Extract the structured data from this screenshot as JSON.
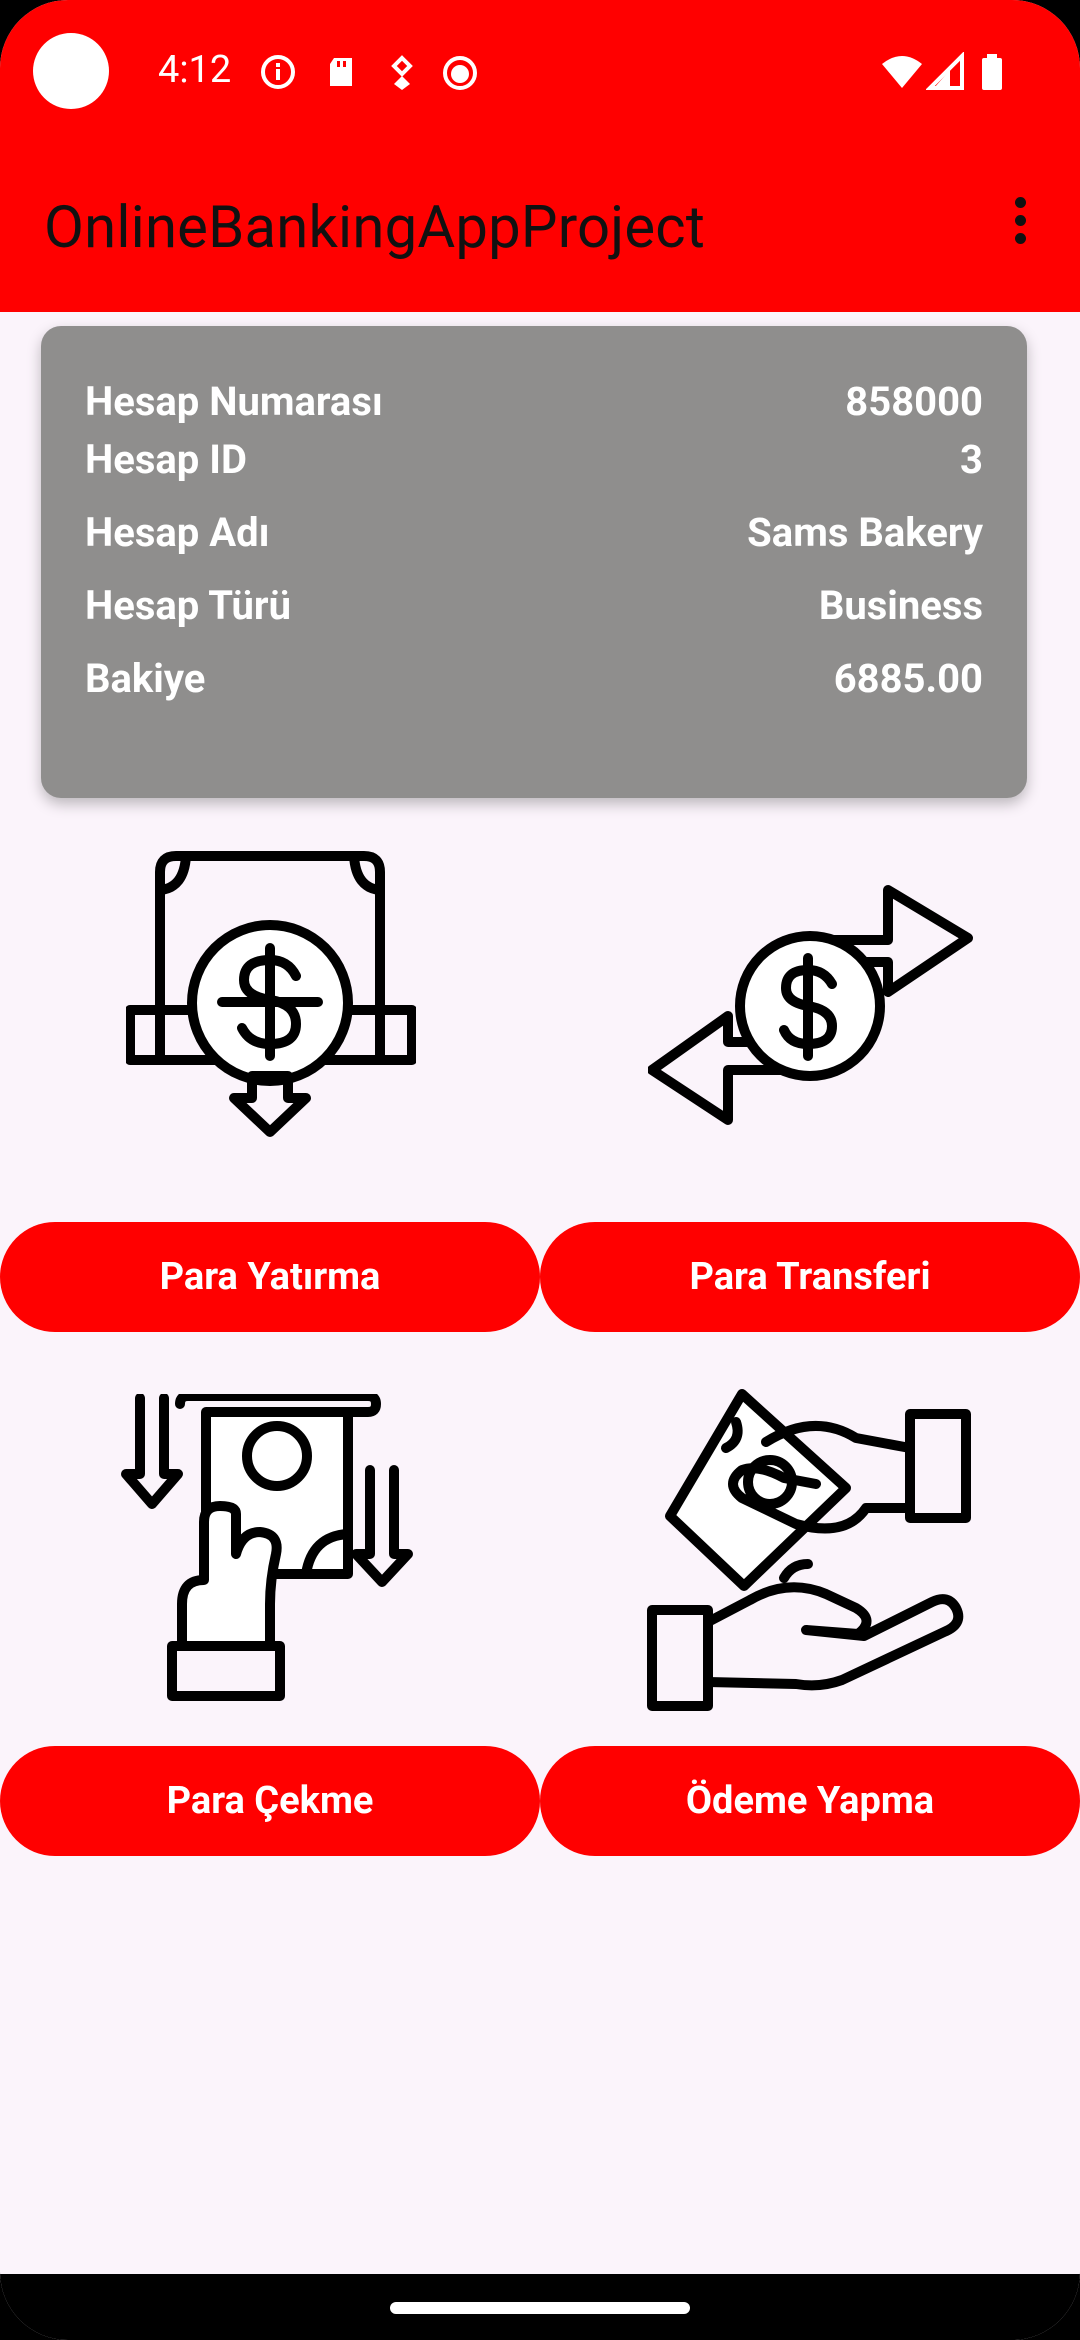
{
  "status_bar": {
    "time": "4:12"
  },
  "app_bar": {
    "title": "OnlineBankingAppProject"
  },
  "account": {
    "rows": [
      {
        "label": "Hesap Numarası",
        "value": "858000"
      },
      {
        "label": "Hesap ID",
        "value": "3"
      },
      {
        "label": "Hesap Adı",
        "value": "Sams Bakery"
      },
      {
        "label": "Hesap Türü",
        "value": "Business"
      },
      {
        "label": "Bakiye",
        "value": "6885.00"
      }
    ]
  },
  "actions": {
    "deposit": "Para Yatırma",
    "transfer": "Para Transferi",
    "withdraw": "Para Çekme",
    "payment": "Ödeme Yapma"
  },
  "colors": {
    "accent": "#ff0000",
    "card": "#8f8e8d",
    "background": "#fbf4fb"
  }
}
